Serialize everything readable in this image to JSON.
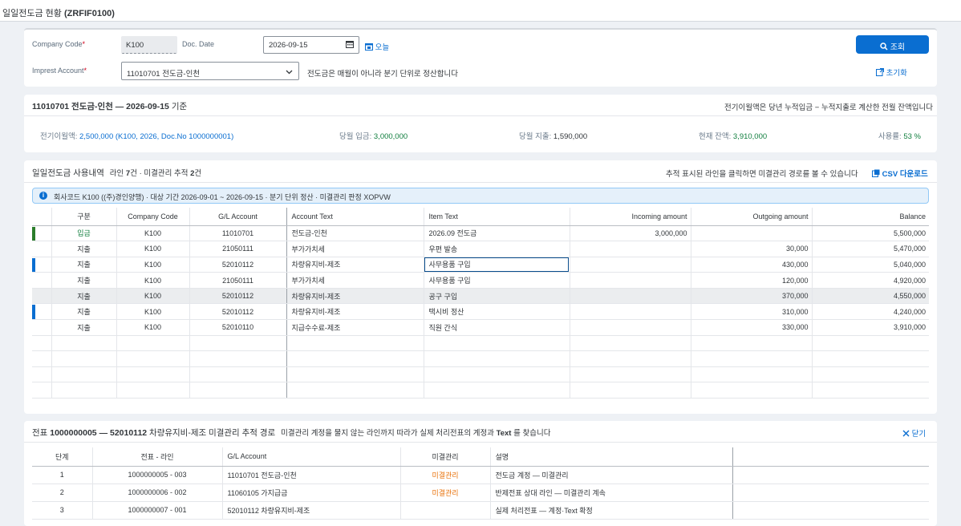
{
  "window": {
    "title_plain": "일일전도금 현황 ",
    "title_code": "(ZRFIF0100)"
  },
  "filters": {
    "company_code_label": "Company Code",
    "company_code_value": "K100",
    "doc_date_label": "Doc. Date",
    "doc_date_value": "2026-09-15",
    "today_label": "오늘",
    "imprest_label": "Imprest Account",
    "imprest_value": "11010701 전도금-인천",
    "imprest_note": "전도금은 매월이 아니라 분기 단위로 정산합니다",
    "search_label": "조회",
    "reset_label": "초기화",
    "required_mark": "*"
  },
  "summary": {
    "title_bold": "11010701 전도금-인천 — 2026-09-15",
    "title_suffix": " 기준",
    "note": "전기이월액은 당년 누적입금 − 누적지출로 계산한 전월 잔액입니다",
    "prev_label": "전기이월액:",
    "prev_value": "2,500,000 (K100, 2026, Doc.No 1000000001)",
    "in_label": "당월 입금:",
    "in_value": "3,000,000",
    "out_label": "당월 지출:",
    "out_value": "1,590,000",
    "bal_label": "현재 잔액:",
    "bal_value": "3,910,000",
    "usage_label": "사용률:",
    "usage_value": "53 %",
    "colors": {
      "in": "#107e3e",
      "prev": "#0a6ed1",
      "bal": "#107e3e",
      "usage": "#107e3e"
    }
  },
  "usage": {
    "title": "일일전도금 사용내역",
    "subtitle_pre": "라인 ",
    "subtitle_lines": "7",
    "subtitle_mid": "건 · 미결관리 추적 ",
    "subtitle_tracked": "2",
    "subtitle_post": "건",
    "hint": "추적 표시된 라인을 클릭하면 미결관리 경로를 볼 수 있습니다",
    "csv_label": "CSV 다운로드",
    "info_text": "회사코드 K100 ((주)경인양행) · 대상 기간 2026-09-01 ~ 2026-09-15 · 분기 단위 정산 · 미결관리 판정 XOPVW",
    "columns": [
      "구분",
      "Company Code",
      "G/L Account",
      "Account Text",
      "Item Text",
      "Incoming amount",
      "Outgoing amount",
      "Balance"
    ],
    "rows": [
      {
        "type": "입금",
        "company": "K100",
        "gl": "11010701",
        "acct_text": "전도금-인천",
        "item_text": "2026.09 전도금",
        "incoming": "3,000,000",
        "outgoing": "",
        "balance": "5,500,000",
        "marker": "green"
      },
      {
        "type": "지출",
        "company": "K100",
        "gl": "21050111",
        "acct_text": "부가가치세",
        "item_text": "우편 발송",
        "incoming": "",
        "outgoing": "30,000",
        "balance": "5,470,000",
        "marker": ""
      },
      {
        "type": "지출",
        "company": "K100",
        "gl": "52010112",
        "acct_text": "차량유지비-제조",
        "item_text": "사무용품 구입",
        "incoming": "",
        "outgoing": "430,000",
        "balance": "5,040,000",
        "marker": "blue"
      },
      {
        "type": "지출",
        "company": "K100",
        "gl": "21050111",
        "acct_text": "부가가치세",
        "item_text": "사무용품 구입",
        "incoming": "",
        "outgoing": "120,000",
        "balance": "4,920,000",
        "marker": ""
      },
      {
        "type": "지출",
        "company": "K100",
        "gl": "52010112",
        "acct_text": "차량유지비-제조",
        "item_text": "공구 구입",
        "incoming": "",
        "outgoing": "370,000",
        "balance": "4,550,000",
        "marker": ""
      },
      {
        "type": "지출",
        "company": "K100",
        "gl": "52010112",
        "acct_text": "차량유지비-제조",
        "item_text": "택시비 정산",
        "incoming": "",
        "outgoing": "310,000",
        "balance": "4,240,000",
        "marker": "blue"
      },
      {
        "type": "지출",
        "company": "K100",
        "gl": "52010110",
        "acct_text": "지급수수료-제조",
        "item_text": "직원 간식",
        "incoming": "",
        "outgoing": "330,000",
        "balance": "3,910,000",
        "marker": ""
      }
    ]
  },
  "trace": {
    "title_pre": "전표 ",
    "title_bold": "1000000005 — 52010112",
    "title_post": " 차량유지비-제조 미결관리 추적 경로",
    "hint_pre": "미결관리 계정을 물지 않는 라인까지 따라가 실제 처리전표의 계정과 ",
    "hint_bold": "Text",
    "hint_post": " 를 찾습니다",
    "close_label": "닫기",
    "columns": [
      "단계",
      "전표 - 라인",
      "G/L Account",
      "미결관리",
      "설명"
    ],
    "rows": [
      {
        "step": "1",
        "doc_line": "1000000005 - 003",
        "gl": "11010701 전도금-인천",
        "open_item": "미결관리",
        "desc": "전도금 계정 — 미결관리"
      },
      {
        "step": "2",
        "doc_line": "1000000006 - 002",
        "gl": "11060105 가지급금",
        "open_item": "미결관리",
        "desc": "반제전표 상대 라인 — 미결관리 계속"
      },
      {
        "step": "3",
        "doc_line": "1000000007 - 001",
        "gl": "52010112 차량유지비-제조",
        "open_item": "",
        "desc": "실제 처리전표 — 계정·Text 확정"
      }
    ]
  }
}
